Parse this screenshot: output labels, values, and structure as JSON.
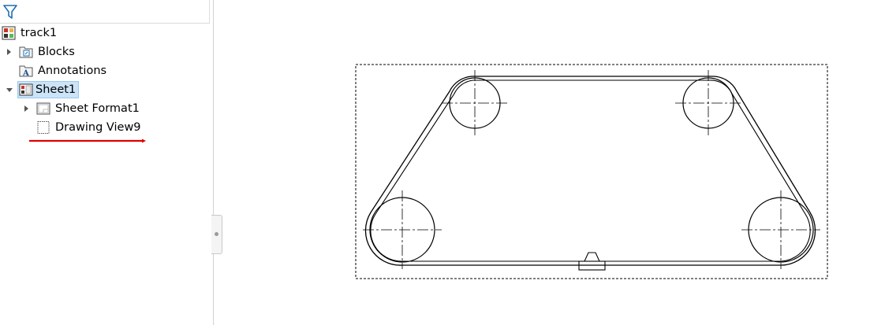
{
  "feature_tree": {
    "filter_icon": "funnel-filter-icon",
    "items": [
      {
        "label": "track1",
        "icon": "drawing-document-icon",
        "expander": "none",
        "selected": false
      },
      {
        "label": "Blocks",
        "icon": "blocks-folder-icon",
        "expander": "collapsed",
        "selected": false
      },
      {
        "label": "Annotations",
        "icon": "annotations-folder-icon",
        "expander": "none",
        "selected": false
      },
      {
        "label": "Sheet1",
        "icon": "sheet-icon",
        "expander": "expanded",
        "selected": true
      },
      {
        "label": "Sheet Format1",
        "icon": "sheet-format-icon",
        "expander": "collapsed",
        "selected": false
      },
      {
        "label": "Drawing View9",
        "icon": "drawing-view-icon",
        "expander": "none",
        "selected": false
      }
    ]
  },
  "colors": {
    "selection_bg": "#cce4f7",
    "selection_border": "#99c9ef",
    "annotation_red": "#e00000",
    "line": "#000000"
  },
  "drawing": {
    "view_name": "Drawing View9",
    "content": "belt-track-with-four-pulleys"
  }
}
